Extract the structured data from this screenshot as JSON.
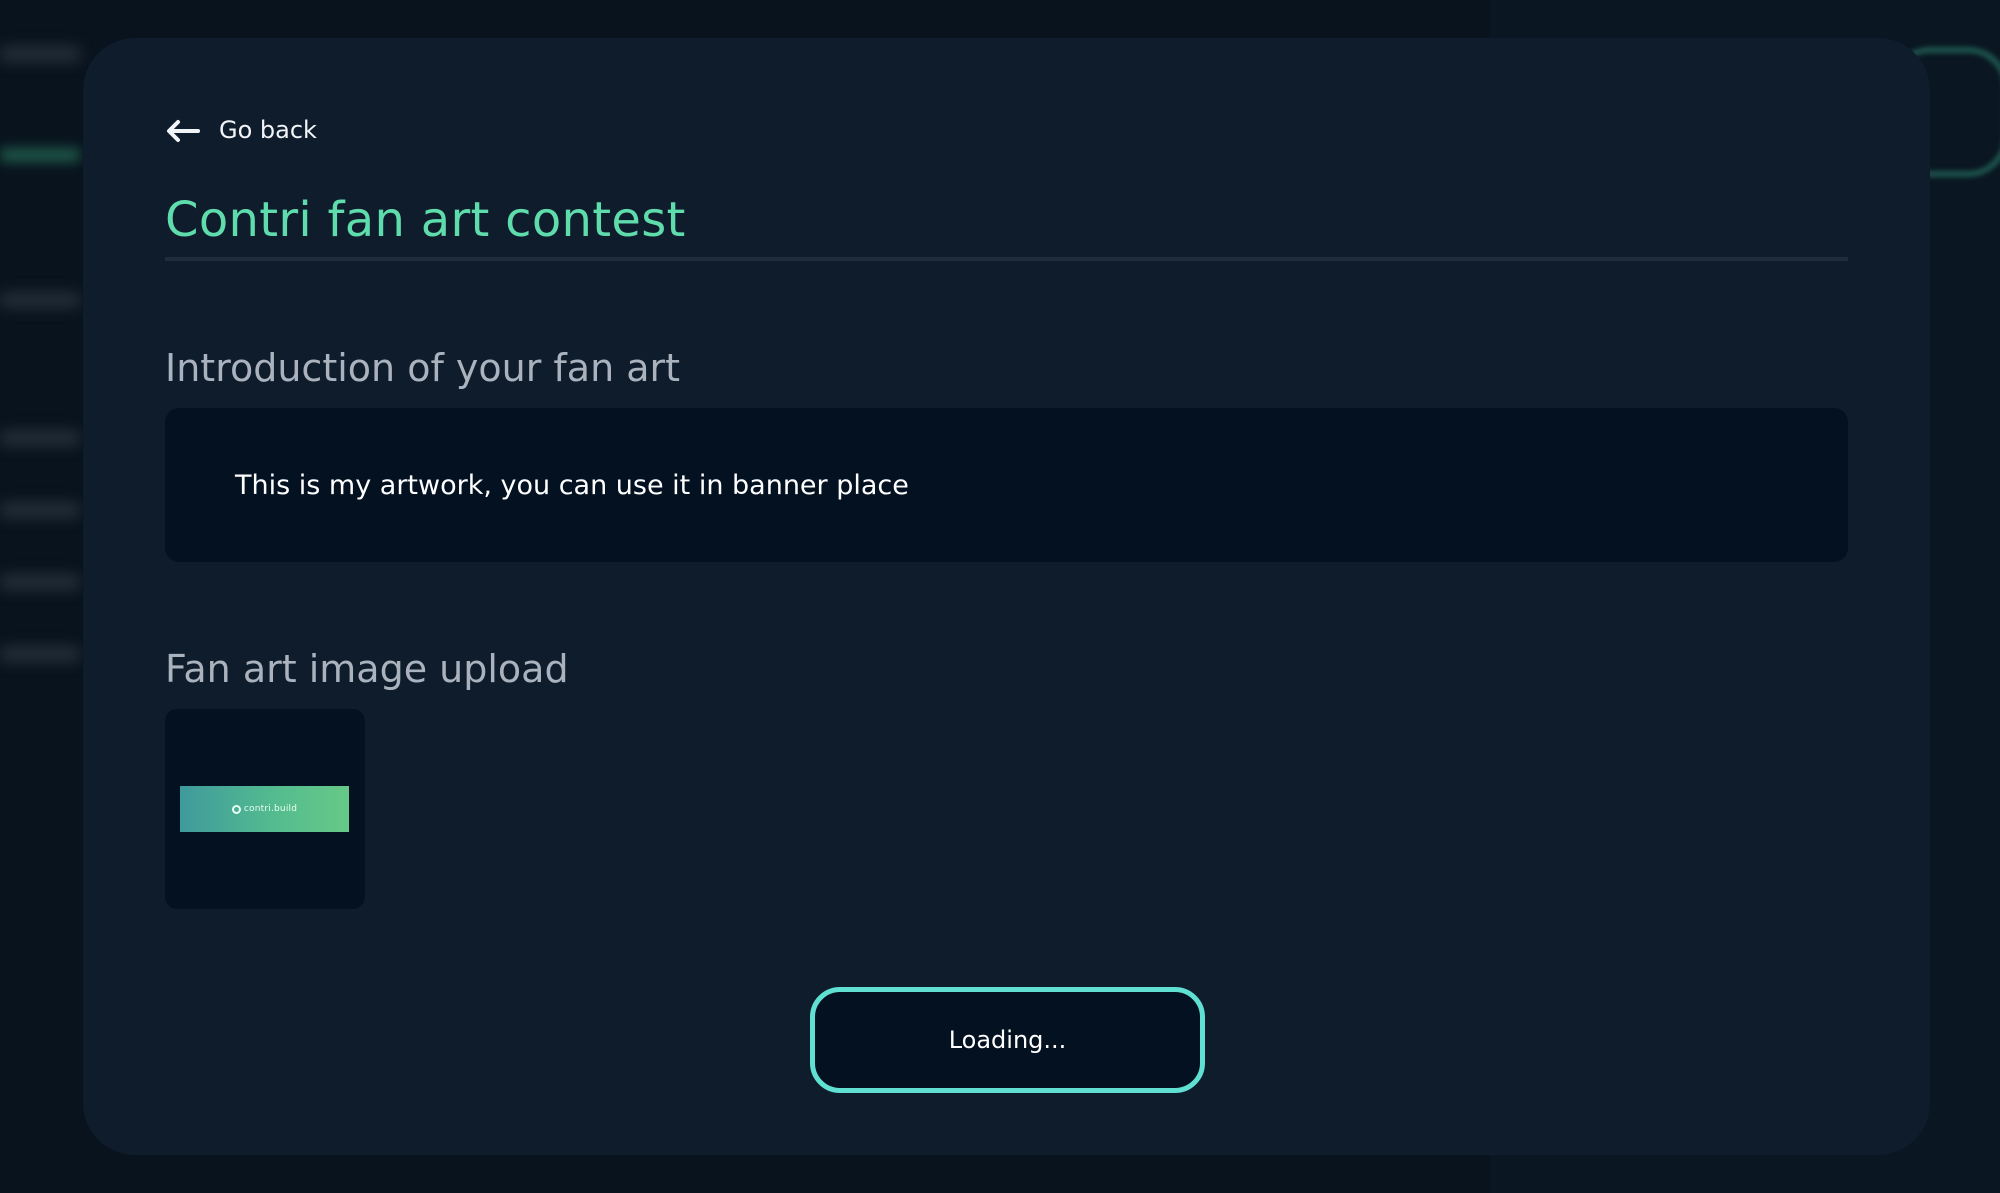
{
  "colors": {
    "accent": "#5fdcab",
    "button_border": "#5fe0d2",
    "modal_background": "#0e1c2c",
    "field_background": "#031121"
  },
  "navigation": {
    "back_label": "Go back",
    "back_icon": "arrow-left-icon"
  },
  "contest": {
    "title": "Contri fan art contest"
  },
  "introduction": {
    "label": "Introduction of your fan art",
    "text": "This is my artwork, you can use it in banner place"
  },
  "upload": {
    "label": "Fan art image upload",
    "thumbnail_logo_text": "contri.build"
  },
  "submit": {
    "label": "Loading..."
  }
}
